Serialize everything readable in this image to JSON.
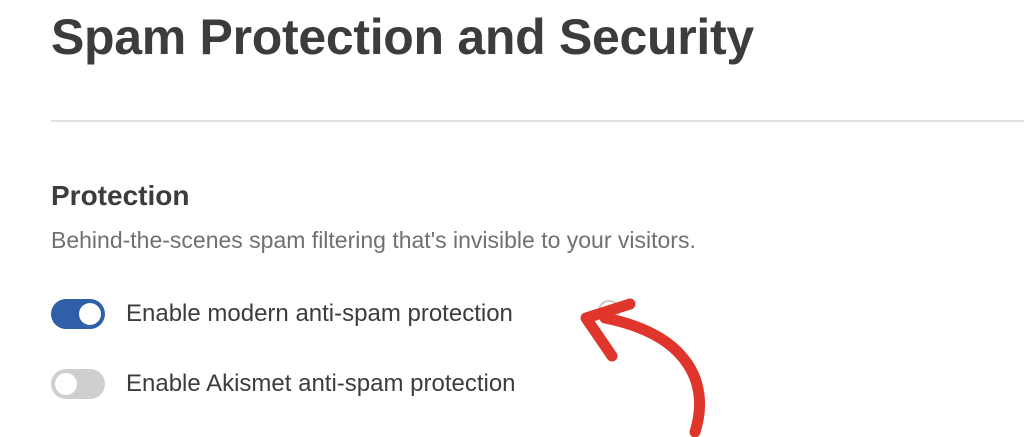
{
  "header": {
    "title": "Spam Protection and Security"
  },
  "protection": {
    "title": "Protection",
    "description": "Behind-the-scenes spam filtering that's invisible to your visitors.",
    "options": [
      {
        "label": "Enable modern anti-spam protection",
        "enabled": true,
        "help_icon": "question-circle-icon"
      },
      {
        "label": "Enable Akismet anti-spam protection",
        "enabled": false
      }
    ]
  },
  "annotation": {
    "arrow_color": "#e0352b"
  },
  "colors": {
    "toggle_on": "#2f5fa7",
    "toggle_off": "#cfcfcf",
    "text": "#3c3c3c",
    "muted_text": "#707070"
  }
}
